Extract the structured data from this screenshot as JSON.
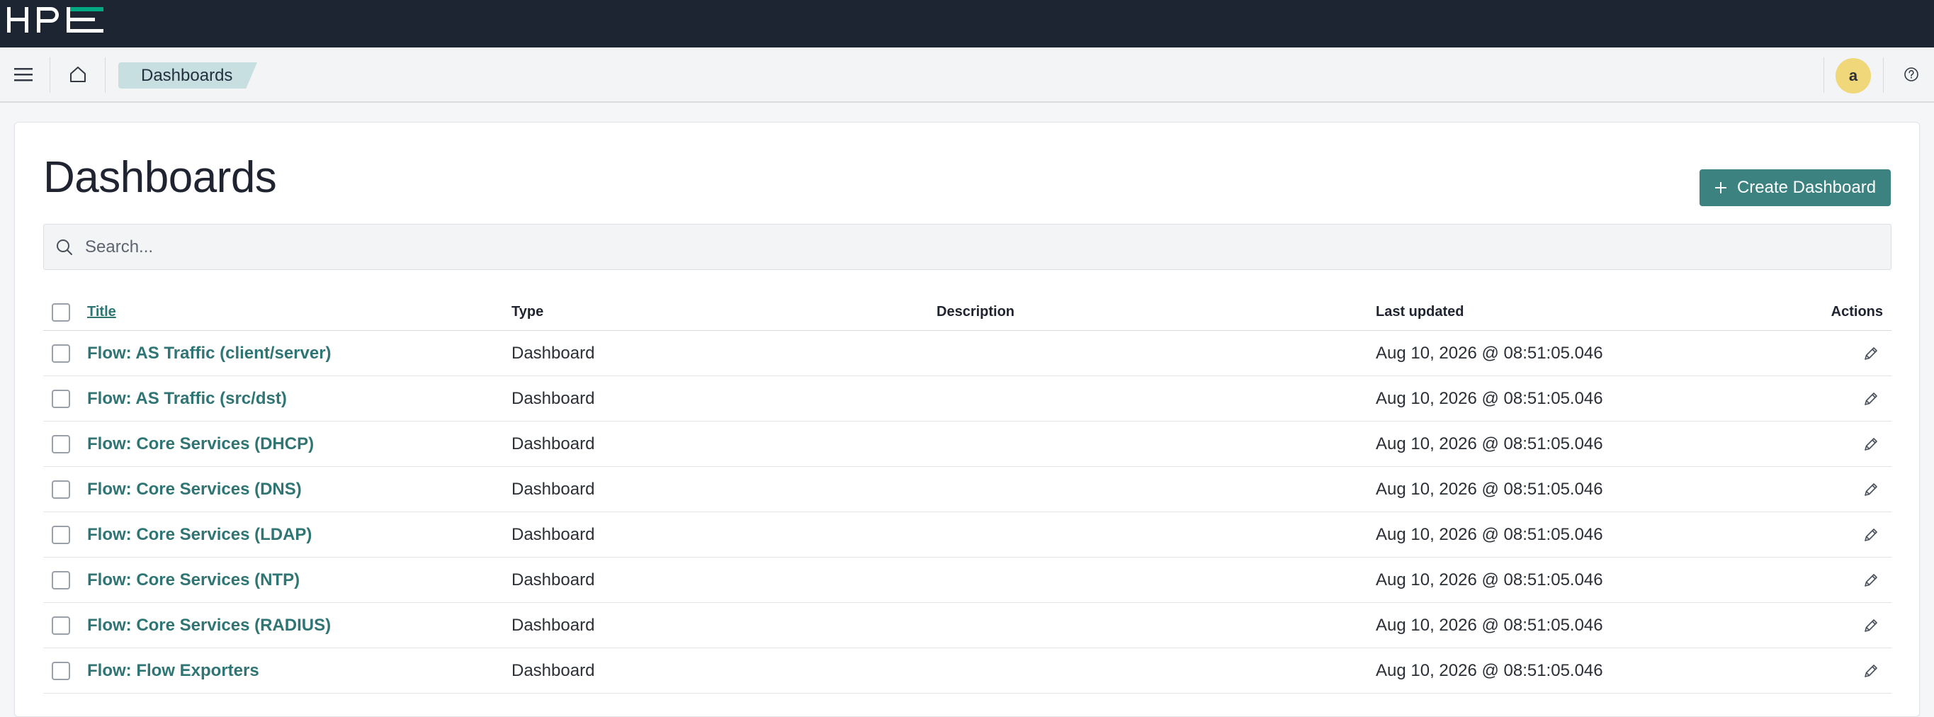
{
  "brand": {
    "logo_text": "HPE"
  },
  "nav": {
    "breadcrumb": "Dashboards",
    "avatar_initial": "a"
  },
  "main": {
    "page_title": "Dashboards",
    "create_button_label": "Create Dashboard",
    "search_placeholder": "Search...",
    "table": {
      "headers": {
        "title": "Title",
        "type": "Type",
        "description": "Description",
        "last_updated": "Last updated",
        "actions": "Actions"
      },
      "rows": [
        {
          "title": "Flow: AS Traffic (client/server)",
          "type": "Dashboard",
          "description": "",
          "last_updated": "Aug 10, 2026 @ 08:51:05.046"
        },
        {
          "title": "Flow: AS Traffic (src/dst)",
          "type": "Dashboard",
          "description": "",
          "last_updated": "Aug 10, 2026 @ 08:51:05.046"
        },
        {
          "title": "Flow: Core Services (DHCP)",
          "type": "Dashboard",
          "description": "",
          "last_updated": "Aug 10, 2026 @ 08:51:05.046"
        },
        {
          "title": "Flow: Core Services (DNS)",
          "type": "Dashboard",
          "description": "",
          "last_updated": "Aug 10, 2026 @ 08:51:05.046"
        },
        {
          "title": "Flow: Core Services (LDAP)",
          "type": "Dashboard",
          "description": "",
          "last_updated": "Aug 10, 2026 @ 08:51:05.046"
        },
        {
          "title": "Flow: Core Services (NTP)",
          "type": "Dashboard",
          "description": "",
          "last_updated": "Aug 10, 2026 @ 08:51:05.046"
        },
        {
          "title": "Flow: Core Services (RADIUS)",
          "type": "Dashboard",
          "description": "",
          "last_updated": "Aug 10, 2026 @ 08:51:05.046"
        },
        {
          "title": "Flow: Flow Exporters",
          "type": "Dashboard",
          "description": "",
          "last_updated": "Aug 10, 2026 @ 08:51:05.046"
        }
      ]
    }
  },
  "colors": {
    "brandbar": "#1c2531",
    "accent": "#3b8280",
    "link": "#2f7573",
    "breadcrumb_bg": "#c7dfe0",
    "avatar_bg": "#f0d77a",
    "logo_accent": "#01a982"
  },
  "icons": [
    "menu-icon",
    "home-icon",
    "help-icon",
    "plus-icon",
    "search-icon",
    "pencil-icon"
  ]
}
